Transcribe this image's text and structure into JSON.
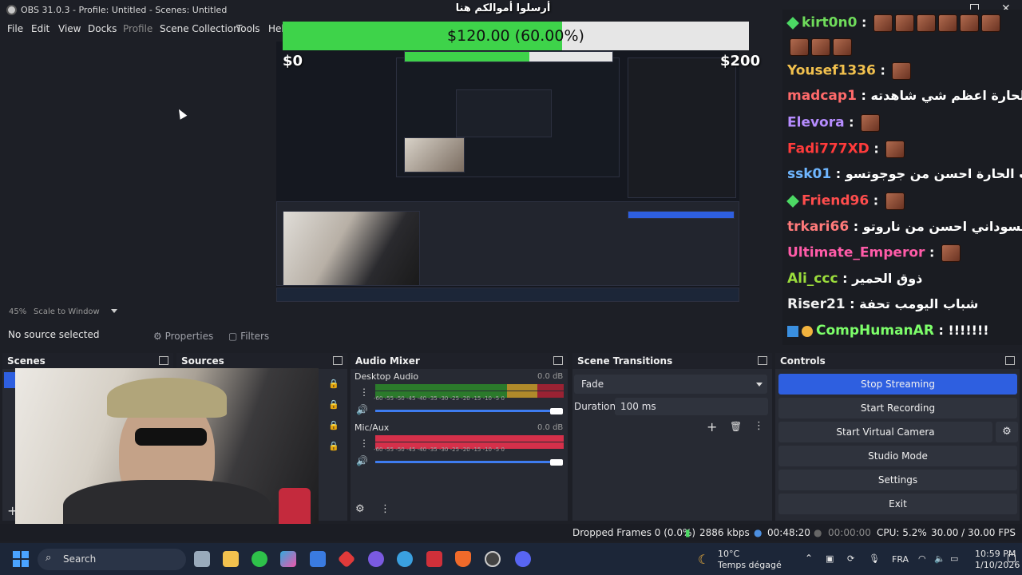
{
  "window": {
    "title": "OBS 31.0.3 - Profile: Untitled - Scenes: Untitled"
  },
  "menu": [
    "File",
    "Edit",
    "View",
    "Docks",
    "Profile",
    "Scene Collection",
    "Tools",
    "Hel"
  ],
  "overlay": {
    "donation_title": "أرسلوا أموالكم هنا",
    "goal_text": "$120.00 (60.00%)",
    "goal_fraction": 0.6,
    "goal_min": "$0",
    "goal_max": "$200"
  },
  "chat": [
    {
      "user": "kirt0n0",
      "color": "#6fdc5b",
      "badge": "gem",
      "text": "",
      "emotes": 11
    },
    {
      "user": "Yousef1336",
      "color": "#f2c14e",
      "badge": "",
      "text": "",
      "emotes": 1
    },
    {
      "user": "madcap1",
      "color": "#ff6a6a",
      "badge": "",
      "text": "باب الحارة اعظم شي شاهدته",
      "emotes": 0
    },
    {
      "user": "Elevora",
      "color": "#b68cff",
      "badge": "",
      "text": "",
      "emotes": 1
    },
    {
      "user": "Fadi777XD",
      "color": "#ff3b3b",
      "badge": "",
      "text": "",
      "emotes": 1
    },
    {
      "user": "ssk01",
      "color": "#6fb6ff",
      "badge": "",
      "text": "باب الحارة احسن من جوجوتسو",
      "emotes": 0
    },
    {
      "user": "Friend96",
      "color": "#ff4d4d",
      "badge": "gem",
      "text": "",
      "emotes": 1
    },
    {
      "user": "trkari66",
      "color": "#ff7a7a",
      "badge": "",
      "text": "فضيل السوداني احسن من ناروتو",
      "emotes": 0
    },
    {
      "user": "Ultimate_Emperor",
      "color": "#ff5ba8",
      "badge": "",
      "text": "",
      "emotes": 1
    },
    {
      "user": "Ali_ccc",
      "color": "#9bdc3c",
      "badge": "",
      "text": "ذوق الحمير",
      "emotes": 0
    },
    {
      "user": "Riser21",
      "color": "#f0f0f0",
      "badge": "",
      "text": "شباب اليومب تحفة",
      "emotes": 0
    },
    {
      "user": "CompHumanAR",
      "color": "#7dff6a",
      "badge": "pro",
      "text": "!!!!!!!",
      "emotes": 0
    }
  ],
  "preview": {
    "zoom": "45%",
    "scale_mode": "Scale to Window",
    "no_source": "No source selected",
    "properties_btn": "Properties",
    "filters_btn": "Filters"
  },
  "docks": {
    "scenes": "Scenes",
    "sources": "Sources",
    "audio_mixer": "Audio Mixer",
    "scene_transitions": "Scene Transitions",
    "controls": "Controls"
  },
  "mixer": {
    "channels": [
      {
        "name": "Desktop Audio",
        "db": "0.0 dB",
        "volume": 1.0
      },
      {
        "name": "Mic/Aux",
        "db": "0.0 dB",
        "volume": 1.0
      }
    ],
    "ticks": "-60  -55  -50  -45  -40  -35  -30  -25  -20  -15  -10   -5    0"
  },
  "transitions": {
    "selected": "Fade",
    "duration_label": "Duration",
    "duration_value": "100 ms"
  },
  "controls": {
    "buttons": [
      "Stop Streaming",
      "Start Recording",
      "Start Virtual Camera",
      "Studio Mode",
      "Settings",
      "Exit"
    ]
  },
  "status": {
    "dropped": "Dropped Frames 0 (0.0%)",
    "kbps": "2886 kbps",
    "stream_time": "00:48:20",
    "rec_time": "00:00:00",
    "cpu": "CPU: 5.2%",
    "fps": "30.00 / 30.00 FPS"
  },
  "taskbar": {
    "search": "Search",
    "weather_temp": "10°C",
    "weather_desc": "Temps dégagé",
    "lang": "FRA",
    "time": "10:59 PM",
    "date": "1/10/2026"
  },
  "colors": {
    "accent": "#2e5fe0",
    "goal_fill": "#3ed34a",
    "meter_green": "#3a9a3a",
    "meter_red": "#d5304a"
  }
}
